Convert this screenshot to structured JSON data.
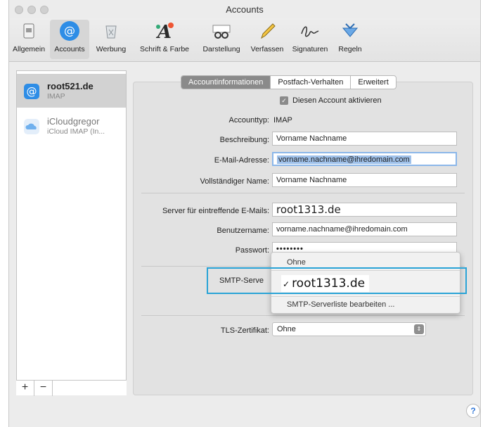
{
  "window": {
    "title": "Accounts"
  },
  "toolbar": {
    "items": [
      {
        "label": "Allgemein",
        "icon": "switch-icon"
      },
      {
        "label": "Accounts",
        "icon": "at-icon"
      },
      {
        "label": "Werbung",
        "icon": "trash-icon"
      },
      {
        "label": "Schrift & Farbe",
        "icon": "font-icon"
      },
      {
        "label": "Darstellung",
        "icon": "glasses-icon"
      },
      {
        "label": "Verfassen",
        "icon": "pencil-icon"
      },
      {
        "label": "Signaturen",
        "icon": "signature-icon"
      },
      {
        "label": "Regeln",
        "icon": "rules-icon"
      }
    ]
  },
  "sidebar": {
    "accounts": [
      {
        "name": "root521.de",
        "type": "IMAP"
      },
      {
        "name": "iCloudgregor",
        "type": "iCloud IMAP (In..."
      }
    ],
    "add_label": "+",
    "remove_label": "−"
  },
  "tabs": [
    "Accountinformationen",
    "Postfach-Verhalten",
    "Erweitert"
  ],
  "form": {
    "enable_label": "Diesen Account aktivieren",
    "account_type_label": "Accounttyp:",
    "account_type_value": "IMAP",
    "description_label": "Beschreibung:",
    "description_value": "Vorname Nachname",
    "email_label": "E-Mail-Adresse:",
    "email_value": "vorname.nachname@ihredomain.com",
    "fullname_label": "Vollständiger Name:",
    "fullname_value": "Vorname Nachname",
    "incoming_label": "Server für eintreffende E-Mails:",
    "incoming_value": "root1313.de",
    "username_label": "Benutzername:",
    "username_value": "vorname.nachname@ihredomain.com",
    "password_label": "Passwort:",
    "password_value": "••••••••",
    "smtp_label": "SMTP-Serve",
    "tls_label": "TLS-Zertifikat:",
    "tls_value": "Ohne"
  },
  "smtp_dropdown": {
    "option_none": "Ohne",
    "selected_check": "✓",
    "selected": "root1313.de",
    "edit_list": "SMTP-Serverliste bearbeiten ..."
  },
  "help_label": "?",
  "colors": {
    "highlight": "#29a3d6",
    "accent": "#3479d8"
  }
}
